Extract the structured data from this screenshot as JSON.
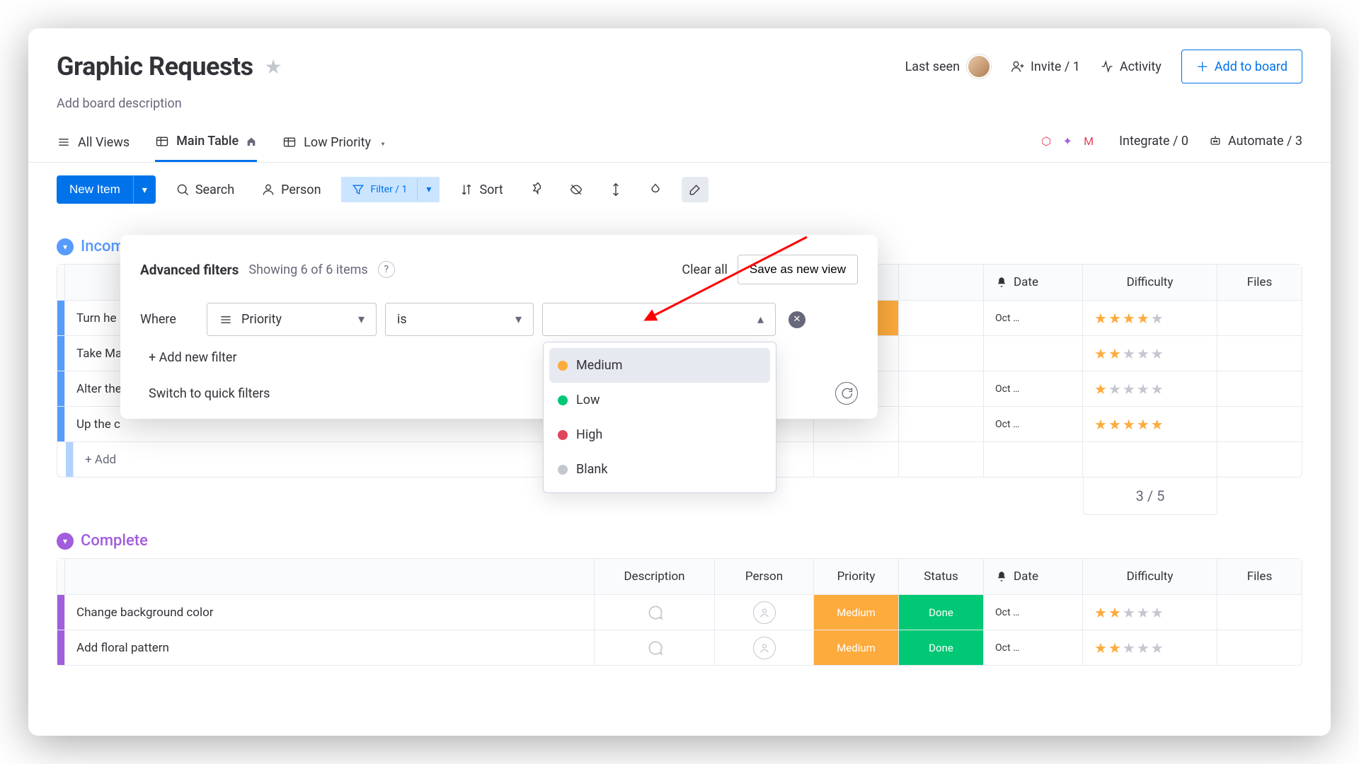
{
  "header": {
    "title": "Graphic Requests",
    "description": "Add board description",
    "last_seen": "Last seen",
    "invite": "Invite / 1",
    "activity": "Activity",
    "add_to_board": "Add to board"
  },
  "views": {
    "all_views": "All Views",
    "main_table": "Main Table",
    "low_priority": "Low Priority",
    "integrate": "Integrate / 0",
    "automate": "Automate / 3"
  },
  "toolbar": {
    "new_item": "New Item",
    "search": "Search",
    "person": "Person",
    "filter": "Filter / 1",
    "sort": "Sort"
  },
  "filter_popover": {
    "title": "Advanced filters",
    "subtitle": "Showing 6 of 6 items",
    "clear_all": "Clear all",
    "save_view": "Save as new view",
    "where": "Where",
    "column": "Priority",
    "operator": "is",
    "add_filter": "+ Add new filter",
    "switch": "Switch to quick filters",
    "options": [
      {
        "label": "Medium",
        "color": "orange",
        "hovered": true
      },
      {
        "label": "Low",
        "color": "green",
        "hovered": false
      },
      {
        "label": "High",
        "color": "red",
        "hovered": false
      },
      {
        "label": "Blank",
        "color": "grey",
        "hovered": false
      }
    ]
  },
  "columns": {
    "description": "Description",
    "person": "Person",
    "priority": "Priority",
    "status": "Status",
    "date": "Date",
    "difficulty": "Difficulty",
    "files": "Files"
  },
  "groups": [
    {
      "name": "Incoming",
      "class": "incoming",
      "rows": [
        {
          "name": "Turn he",
          "date": "Oct …",
          "stars": 4
        },
        {
          "name": "Take Ma",
          "date": "",
          "stars": 2
        },
        {
          "name": "Alter the",
          "date": "Oct …",
          "stars": 1
        },
        {
          "name": "Up the c",
          "date": "Oct …",
          "stars": 5
        }
      ],
      "add_label": "+ Add",
      "summary": "3  / 5"
    },
    {
      "name": "Complete",
      "class": "complete",
      "rows": [
        {
          "name": "Change background color",
          "priority": "Medium",
          "status": "Done",
          "date": "Oct …",
          "stars": 2
        },
        {
          "name": "Add floral pattern",
          "priority": "Medium",
          "status": "Done",
          "date": "Oct …",
          "stars": 2
        }
      ]
    }
  ]
}
